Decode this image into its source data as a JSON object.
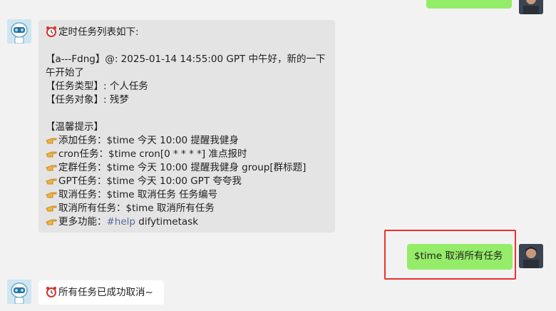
{
  "chat": {
    "top_partial_message": "",
    "bot_message_1": {
      "header": "定时任务列表如下:",
      "task_line": "【a---Fdng】@: 2025-01-14 14:55:00 GPT 中午好，新的一下午开始了",
      "task_type": "【任务类型】: 个人任务",
      "task_target": "【任务对象】: 残梦",
      "tips_title": "【温馨提示】",
      "tips": [
        {
          "text": "添加任务：$time 今天 10:00 提醒我健身"
        },
        {
          "text": "cron任务：$time cron[0 * * * *] 准点报时"
        },
        {
          "text": "定群任务：$time 今天 10:00 提醒我健身 group[群标题]"
        },
        {
          "text": "GPT任务：$time 今天 10:00 GPT 夸夸我"
        },
        {
          "text": "取消任务：$time 取消任务 任务编号"
        },
        {
          "text": "取消所有任务：$time 取消所有任务"
        }
      ],
      "more_prefix": "更多功能：",
      "more_link": "#help",
      "more_suffix": " difytimetask"
    },
    "user_message": {
      "text": "$time 取消所有任务"
    },
    "bot_message_2": {
      "text": "所有任务已成功取消~"
    },
    "colors": {
      "highlight": "#e8322d",
      "user_bubble": "#95ec69",
      "link": "#576b95"
    },
    "icons": {
      "alarm": "alarm-clock-icon",
      "pointing": "pointing-hand-icon"
    }
  }
}
